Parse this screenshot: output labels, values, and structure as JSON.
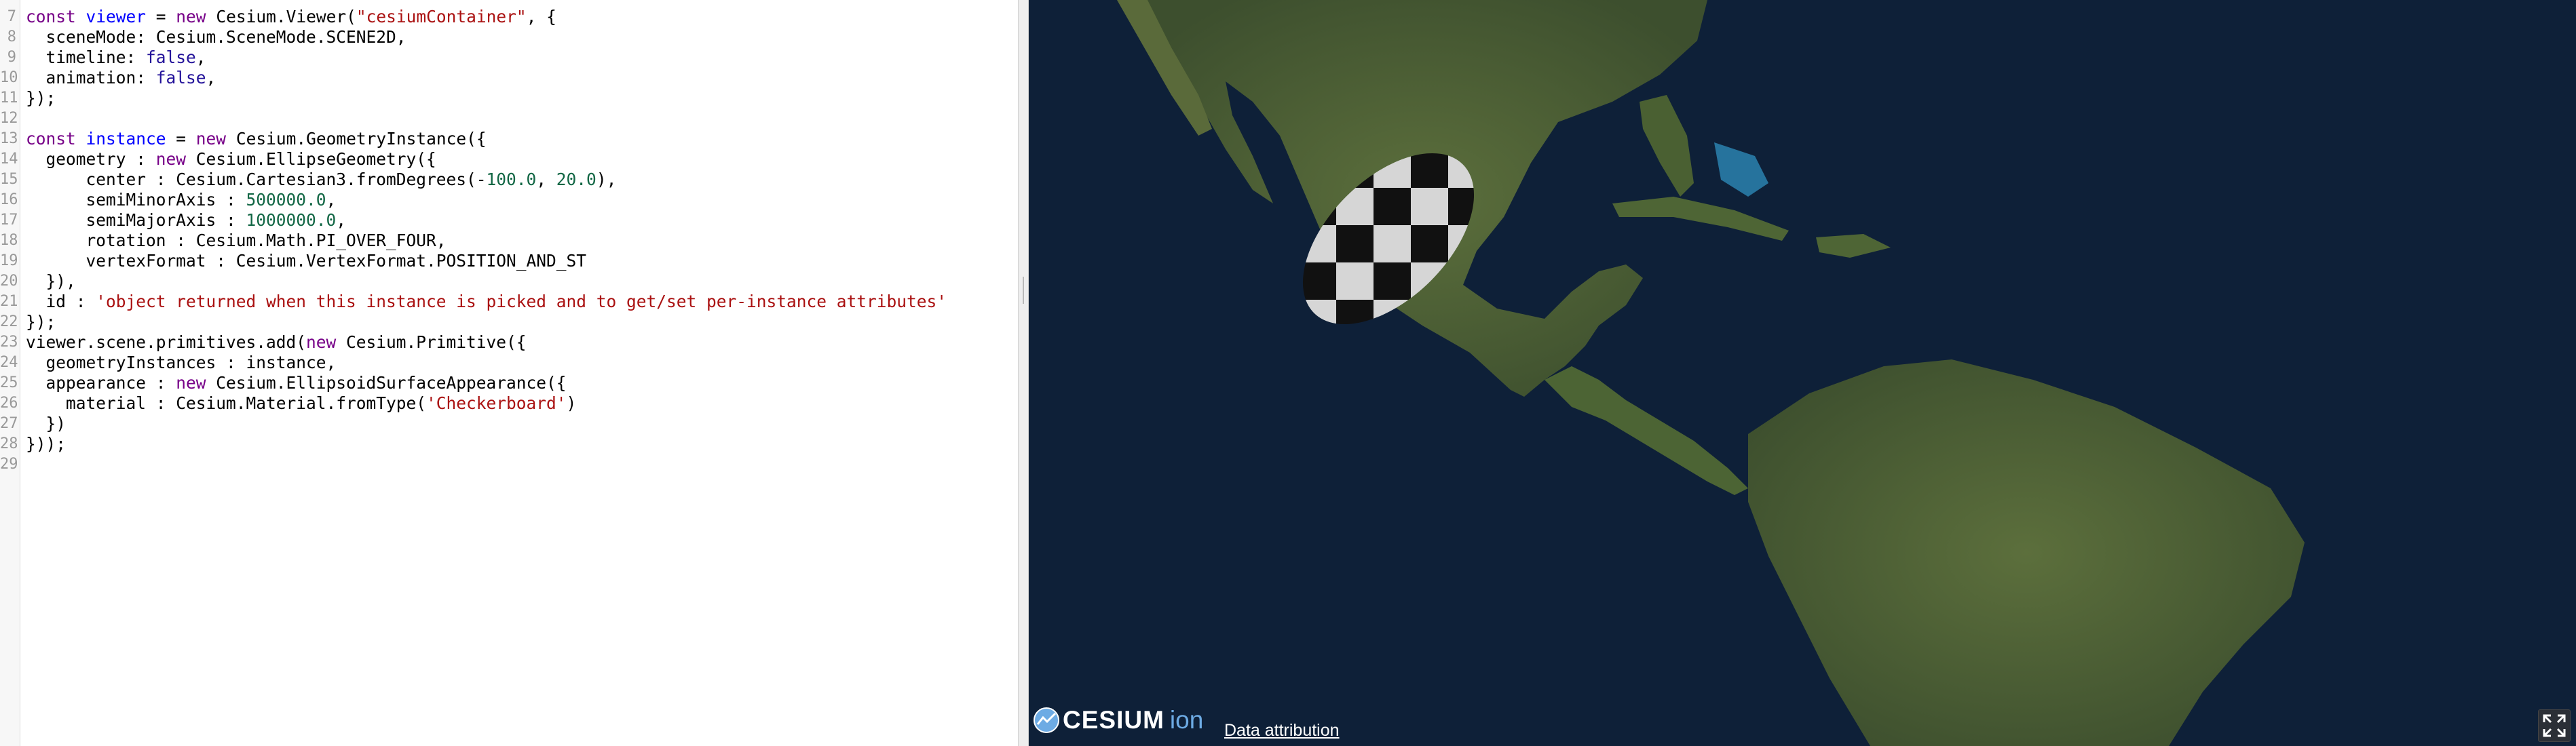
{
  "editor": {
    "lines": [
      {
        "n": "7",
        "tokens": [
          [
            "kw",
            "const "
          ],
          [
            "def",
            "viewer"
          ],
          [
            "",
            " = "
          ],
          [
            "kw",
            "new"
          ],
          [
            "",
            " Cesium.Viewer("
          ],
          [
            "str",
            "\"cesiumContainer\""
          ],
          [
            "",
            ", {"
          ]
        ]
      },
      {
        "n": "8",
        "tokens": [
          [
            "",
            "  sceneMode: Cesium.SceneMode.SCENE2D,"
          ]
        ]
      },
      {
        "n": "9",
        "tokens": [
          [
            "",
            "  timeline: "
          ],
          [
            "atom",
            "false"
          ],
          [
            "",
            ","
          ]
        ]
      },
      {
        "n": "10",
        "tokens": [
          [
            "",
            "  animation: "
          ],
          [
            "atom",
            "false"
          ],
          [
            "",
            ","
          ]
        ]
      },
      {
        "n": "11",
        "tokens": [
          [
            "",
            "});"
          ]
        ]
      },
      {
        "n": "12",
        "tokens": []
      },
      {
        "n": "13",
        "tokens": [
          [
            "kw",
            "const "
          ],
          [
            "def",
            "instance"
          ],
          [
            "",
            " = "
          ],
          [
            "kw",
            "new"
          ],
          [
            "",
            " Cesium.GeometryInstance({"
          ]
        ]
      },
      {
        "n": "14",
        "tokens": [
          [
            "",
            "  geometry : "
          ],
          [
            "kw",
            "new"
          ],
          [
            "",
            " Cesium.EllipseGeometry({"
          ]
        ]
      },
      {
        "n": "15",
        "tokens": [
          [
            "",
            "      center : Cesium.Cartesian3.fromDegrees(-"
          ],
          [
            "num",
            "100.0"
          ],
          [
            "",
            ", "
          ],
          [
            "num",
            "20.0"
          ],
          [
            "",
            "),"
          ]
        ]
      },
      {
        "n": "16",
        "tokens": [
          [
            "",
            "      semiMinorAxis : "
          ],
          [
            "num",
            "500000.0"
          ],
          [
            "",
            ","
          ]
        ]
      },
      {
        "n": "17",
        "tokens": [
          [
            "",
            "      semiMajorAxis : "
          ],
          [
            "num",
            "1000000.0"
          ],
          [
            "",
            ","
          ]
        ]
      },
      {
        "n": "18",
        "tokens": [
          [
            "",
            "      rotation : Cesium.Math.PI_OVER_FOUR,"
          ]
        ]
      },
      {
        "n": "19",
        "tokens": [
          [
            "",
            "      vertexFormat : Cesium.VertexFormat.POSITION_AND_ST"
          ]
        ]
      },
      {
        "n": "20",
        "tokens": [
          [
            "",
            "  }),"
          ]
        ]
      },
      {
        "n": "21",
        "tokens": [
          [
            "",
            "  id : "
          ],
          [
            "str",
            "'object returned when this instance is picked and to get/set per-instance attributes'"
          ]
        ]
      },
      {
        "n": "22",
        "tokens": [
          [
            "",
            "});"
          ]
        ]
      },
      {
        "n": "23",
        "tokens": [
          [
            "",
            "viewer.scene.primitives.add("
          ],
          [
            "kw",
            "new"
          ],
          [
            "",
            " Cesium.Primitive({"
          ]
        ]
      },
      {
        "n": "24",
        "tokens": [
          [
            "",
            "  geometryInstances : instance,"
          ]
        ]
      },
      {
        "n": "25",
        "tokens": [
          [
            "",
            "  appearance : "
          ],
          [
            "kw",
            "new"
          ],
          [
            "",
            " Cesium.EllipsoidSurfaceAppearance({"
          ]
        ]
      },
      {
        "n": "26",
        "tokens": [
          [
            "",
            "    material : Cesium.Material.fromType("
          ],
          [
            "str",
            "'Checkerboard'"
          ],
          [
            "",
            ")"
          ]
        ]
      },
      {
        "n": "27",
        "tokens": [
          [
            "",
            "  })"
          ]
        ]
      },
      {
        "n": "28",
        "tokens": [
          [
            "",
            "}));"
          ]
        ]
      },
      {
        "n": "29",
        "tokens": []
      }
    ]
  },
  "viewer": {
    "logo_word": "CESIUM",
    "logo_ion": "ion",
    "data_attribution": "Data attribution",
    "fullscreen_icon": "fullscreen-icon",
    "ellipse_material": "Checkerboard",
    "colors": {
      "ocean": "#0e2038",
      "land": "#4f6438",
      "checker_dark": "#111111",
      "checker_light": "#d6d6d6"
    }
  }
}
